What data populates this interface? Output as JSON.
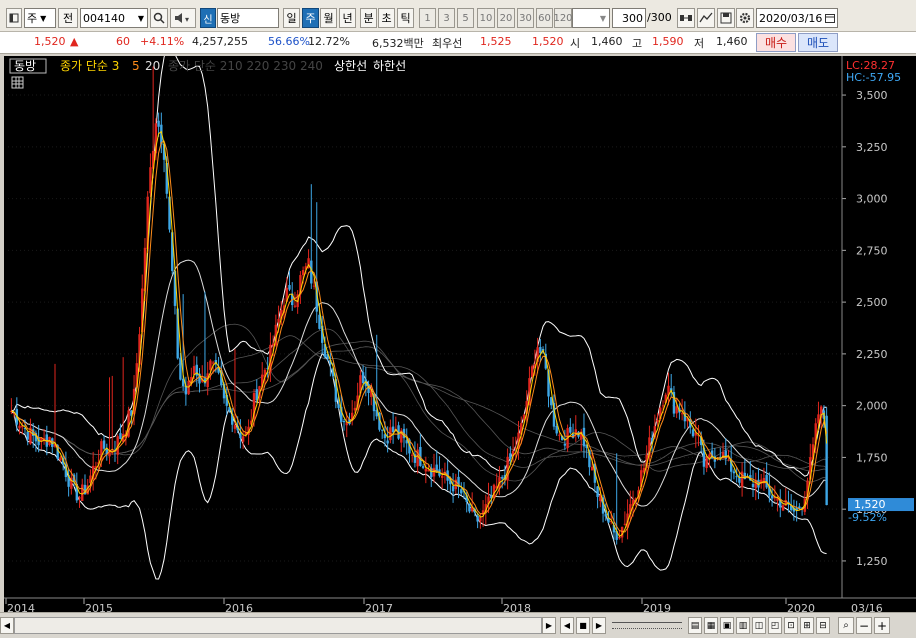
{
  "toolbar": {
    "market": "주",
    "period": "전",
    "code": "004140",
    "badge": "신",
    "stock_name": "동방",
    "timeframes": [
      "일",
      "주",
      "월",
      "년",
      "분",
      "초",
      "틱"
    ],
    "active_timeframe": "주",
    "intervals": [
      "1",
      "3",
      "5",
      "10",
      "20",
      "30",
      "60",
      "120"
    ],
    "count": "300",
    "count_total": "/300",
    "date": "2020/03/16"
  },
  "quote": {
    "price": "1,520",
    "arrow": "▲",
    "change": "60",
    "change_pct": "+4.11%",
    "volume": "4,257,255",
    "vol_ratio": "56.66%",
    "turnover": "12.72%",
    "amount": "6,532백만",
    "prio_label": "최우선",
    "ask": "1,525",
    "bid": "1,520",
    "open_label": "시",
    "open": "1,460",
    "high_label": "고",
    "high": "1,590",
    "low_label": "저",
    "low": "1,460",
    "buy": "매수",
    "sell": "매도"
  },
  "chart_overlay": {
    "name_tag": "동방",
    "ma_label": "종가 단순 3",
    "ma_periods": [
      "5",
      "20"
    ],
    "hidden_ma": "종가 단순 210  220  230  240",
    "upper_limit": "상한선",
    "lower_limit": "하한선",
    "lc": "LC:28.27",
    "hc": "HC:-57.95",
    "current_price": "1,520",
    "current_pct": "-9.52%"
  },
  "colors": {
    "up": "#e0261e",
    "down": "#3ea7e6",
    "ma3": "#ffd400",
    "ma5": "#ff8c1a",
    "band": "#ffffff"
  },
  "chart_data": {
    "type": "candlestick",
    "y_axis_ticks": [
      "3,500",
      "3,250",
      "3,000",
      "2,750",
      "2,500",
      "2,250",
      "2,000",
      "1,750",
      "1,500",
      "1,250"
    ],
    "ylim": [
      1100,
      3650
    ],
    "x_axis_ticks": [
      "2014",
      "2015",
      "2016",
      "2017",
      "2018",
      "2019",
      "2020"
    ],
    "last_date_label": "03/16",
    "close": [
      1975,
      1930,
      1880,
      1840,
      1820,
      1850,
      1780,
      1700,
      1600,
      1560,
      1620,
      1720,
      1800,
      1780,
      1830,
      1900,
      2000,
      2450,
      3050,
      3400,
      3250,
      2700,
      2150,
      2050,
      2200,
      2100,
      2200,
      2150,
      2000,
      1950,
      1870,
      1850,
      2050,
      2150,
      2250,
      2400,
      2550,
      2500,
      2620,
      2680,
      2500,
      2300,
      2150,
      1980,
      1920,
      2000,
      2150,
      2100,
      1950,
      1850,
      1880,
      1850,
      1800,
      1760,
      1740,
      1700,
      1680,
      1640,
      1620,
      1580,
      1500,
      1440,
      1480,
      1550,
      1620,
      1700,
      1780,
      1900,
      2100,
      2300,
      2200,
      1950,
      1850,
      1850,
      1900,
      1850,
      1700,
      1560,
      1480,
      1380,
      1400,
      1500,
      1600,
      1700,
      1850,
      1980,
      2100,
      2000,
      1980,
      1900,
      1850,
      1700,
      1760,
      1780,
      1720,
      1680,
      1640,
      1620,
      1640,
      1600,
      1560,
      1540,
      1500,
      1480,
      1560,
      1740,
      1980,
      1920
    ],
    "last_close": 1520
  },
  "scrollbar": {
    "left_arrow": "◀",
    "right_arrow": "▶",
    "zoom_in": "+",
    "zoom_out": "−"
  }
}
